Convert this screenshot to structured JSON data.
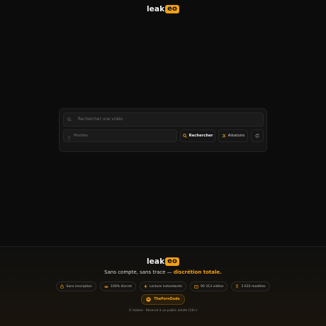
{
  "header": {
    "logo_text": "leak",
    "logo_badge": "eo"
  },
  "search": {
    "video_placeholder": "Rechercher une vidéo",
    "model_placeholder": "Modèle",
    "search_button": "Rechercher",
    "random_button": "Aléatoire"
  },
  "footer": {
    "logo_text": "leak",
    "logo_badge": "eo",
    "tagline_prefix": "Sans compte, sans trace — ",
    "tagline_accent": "discrétion totale.",
    "stats": [
      {
        "icon": "lock-icon",
        "label": "Sans inscription"
      },
      {
        "icon": "eye-icon",
        "label": "100% discret"
      },
      {
        "icon": "lightning-icon",
        "label": "Lecture instantanée"
      },
      {
        "icon": "video-icon",
        "label": "90 313 vidéos"
      },
      {
        "icon": "user-icon",
        "label": "3 633 modèles"
      }
    ],
    "partner_label": "ThePornDude",
    "copyright": "© leakeo · Réservé à un public adulte (18+)"
  },
  "colors": {
    "accent": "#f4a017",
    "background": "#0c0c0c"
  }
}
